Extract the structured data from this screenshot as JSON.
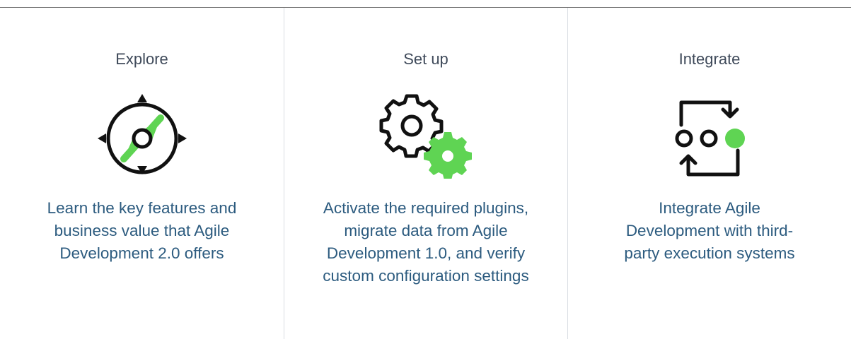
{
  "cards": [
    {
      "title": "Explore",
      "icon": "compass-icon",
      "description": "Learn the key features and business value that Agile Development 2.0 offers"
    },
    {
      "title": "Set up",
      "icon": "gears-icon",
      "description": "Activate the required plugins, migrate data from Agile Development 1.0, and verify custom configuration settings"
    },
    {
      "title": "Integrate",
      "icon": "integration-cycle-icon",
      "description": "Integrate Agile Development with third-party execution systems"
    }
  ],
  "colors": {
    "title_text": "#3f4a5a",
    "description_text": "#2c5b7f",
    "accent_green": "#5fd453",
    "icon_stroke": "#111111",
    "divider": "#d9dde2"
  }
}
